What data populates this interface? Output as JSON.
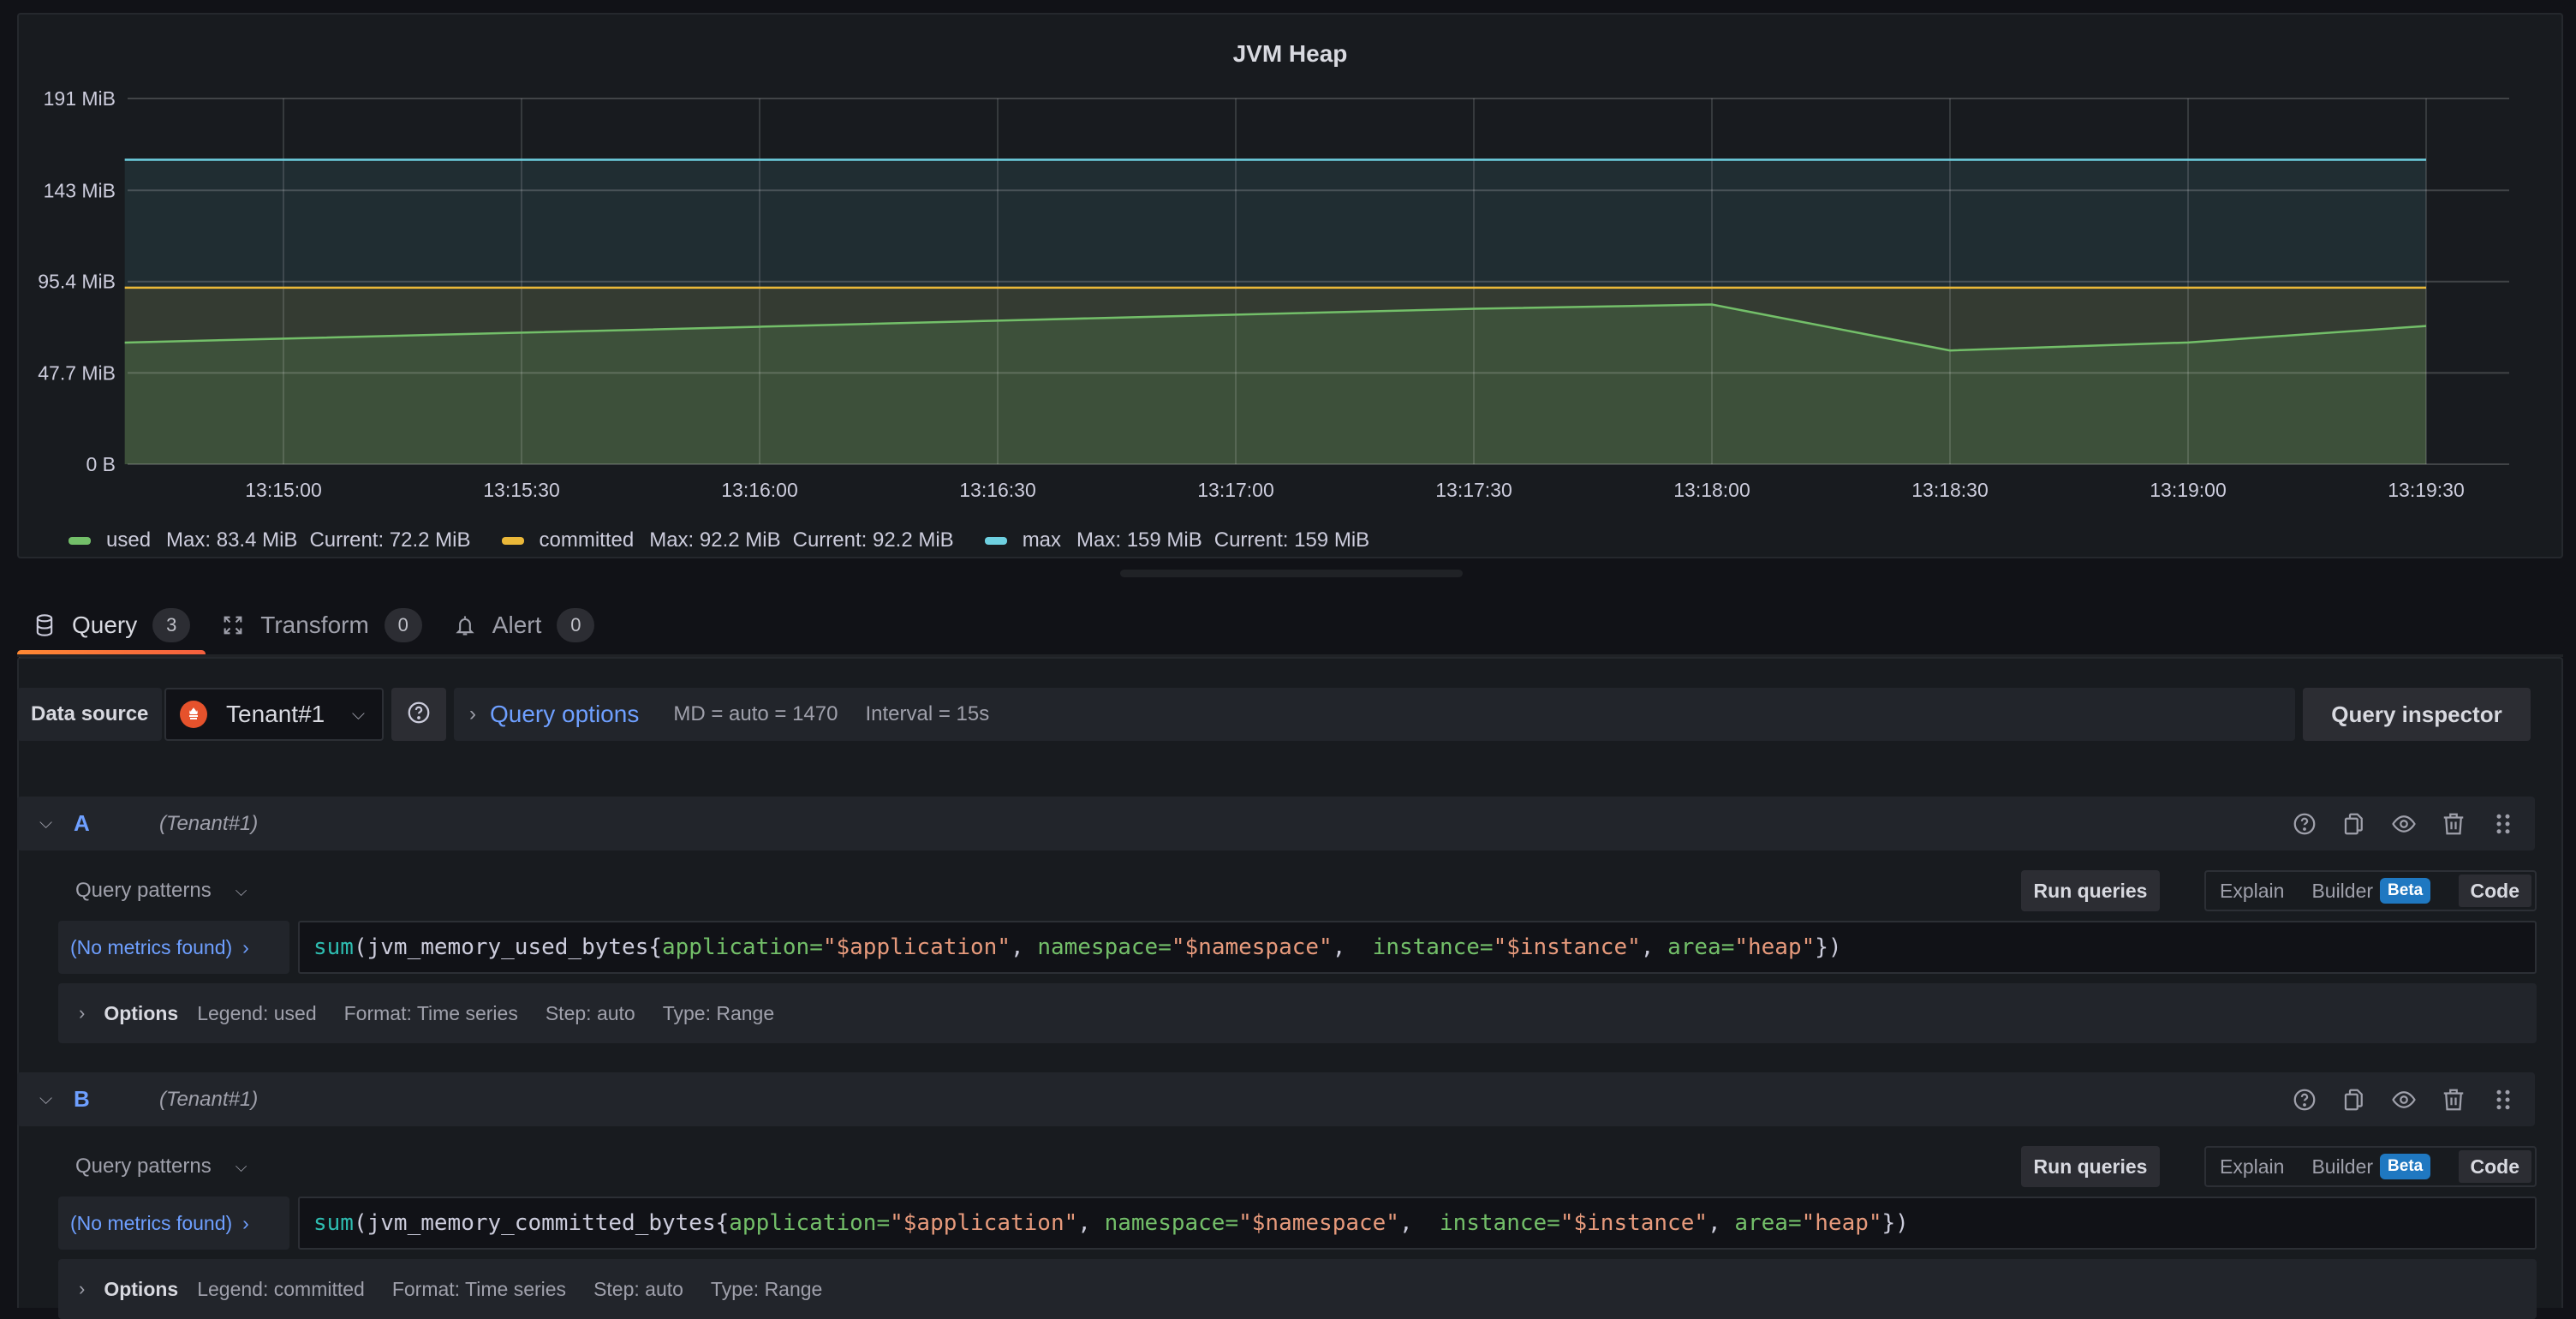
{
  "panel": {
    "title": "JVM Heap"
  },
  "chart_data": {
    "type": "area",
    "title": "JVM Heap",
    "xlabel": "",
    "ylabel": "",
    "x_range_seconds": [
      -20,
      305
    ],
    "x_origin": "13:15:00",
    "x_ticks": [
      "13:15:00",
      "13:15:30",
      "13:16:00",
      "13:16:30",
      "13:17:00",
      "13:17:30",
      "13:18:00",
      "13:18:30",
      "13:19:00",
      "13:19:30"
    ],
    "y_ticks": [
      "0 B",
      "47.7 MiB",
      "95.4 MiB",
      "143 MiB",
      "191 MiB"
    ],
    "y_tick_values_mib": [
      0,
      47.7,
      95.4,
      143,
      191
    ],
    "ylim_mib": [
      0,
      191
    ],
    "grid": true,
    "legend_position": "bottom-left",
    "series": [
      {
        "name": "used",
        "color": "#73bf69",
        "x_seconds": [
          -20,
          0,
          30,
          60,
          90,
          120,
          150,
          180,
          210,
          240,
          270
        ],
        "values_mib": [
          63.5,
          65.6,
          68.7,
          71.8,
          75.0,
          78.1,
          81.2,
          83.4,
          59.4,
          63.6,
          72.2
        ],
        "stats": {
          "max": "Max: 83.4 MiB",
          "current": "Current: 72.2 MiB"
        }
      },
      {
        "name": "committed",
        "color": "#fade2a",
        "x_seconds": [
          -20,
          270
        ],
        "values_mib": [
          92.2,
          92.2
        ],
        "stats": {
          "max": "Max: 92.2 MiB",
          "current": "Current: 92.2 MiB"
        }
      },
      {
        "name": "max",
        "color": "#6ed0e0",
        "x_seconds": [
          -20,
          270
        ],
        "values_mib": [
          159,
          159
        ],
        "stats": {
          "max": "Max: 159 MiB",
          "current": "Current: 159 MiB"
        }
      }
    ]
  },
  "tabs": [
    {
      "label": "Query",
      "count": "3",
      "icon": "database-icon",
      "active": true
    },
    {
      "label": "Transform",
      "count": "0",
      "icon": "transform-icon",
      "active": false
    },
    {
      "label": "Alert",
      "count": "0",
      "icon": "bell-icon",
      "active": false
    }
  ],
  "datasource": {
    "label": "Data source",
    "selected": "Tenant#1",
    "icon": "prometheus-icon",
    "help_icon": "help-circle-icon"
  },
  "query_options": {
    "title": "Query options",
    "max_data_points": "MD = auto = 1470",
    "interval": "Interval = 15s"
  },
  "query_inspector_label": "Query inspector",
  "queries": [
    {
      "ref": "A",
      "datasource": "(Tenant#1)",
      "patterns_label": "Query patterns",
      "run_label": "Run queries",
      "modes": {
        "explain": "Explain",
        "builder": "Builder",
        "beta": "Beta",
        "code": "Code",
        "active": "Code"
      },
      "metrics_label": "(No metrics found)",
      "code": {
        "fn": "sum",
        "metric": "(jvm_memory_used_bytes{",
        "labels": [
          {
            "key": "application",
            "value": "\"$application\"",
            "sep": ", "
          },
          {
            "key": "namespace",
            "value": "\"$namespace\"",
            "sep": ",  "
          },
          {
            "key": "instance",
            "value": "\"$instance\"",
            "sep": ", "
          },
          {
            "key": "area",
            "value": "\"heap\"",
            "sep": ""
          }
        ],
        "close": "})"
      },
      "options": {
        "label": "Options",
        "legend": "Legend: used",
        "format": "Format: Time series",
        "step": "Step: auto",
        "type": "Type: Range"
      }
    },
    {
      "ref": "B",
      "datasource": "(Tenant#1)",
      "patterns_label": "Query patterns",
      "run_label": "Run queries",
      "modes": {
        "explain": "Explain",
        "builder": "Builder",
        "beta": "Beta",
        "code": "Code",
        "active": "Code"
      },
      "metrics_label": "(No metrics found)",
      "code": {
        "fn": "sum",
        "metric": "(jvm_memory_committed_bytes{",
        "labels": [
          {
            "key": "application",
            "value": "\"$application\"",
            "sep": ", "
          },
          {
            "key": "namespace",
            "value": "\"$namespace\"",
            "sep": ",  "
          },
          {
            "key": "instance",
            "value": "\"$instance\"",
            "sep": ", "
          },
          {
            "key": "area",
            "value": "\"heap\"",
            "sep": ""
          }
        ],
        "close": "})"
      },
      "options": {
        "label": "Options",
        "legend": "Legend: committed",
        "format": "Format: Time series",
        "step": "Step: auto",
        "type": "Type: Range"
      }
    }
  ]
}
